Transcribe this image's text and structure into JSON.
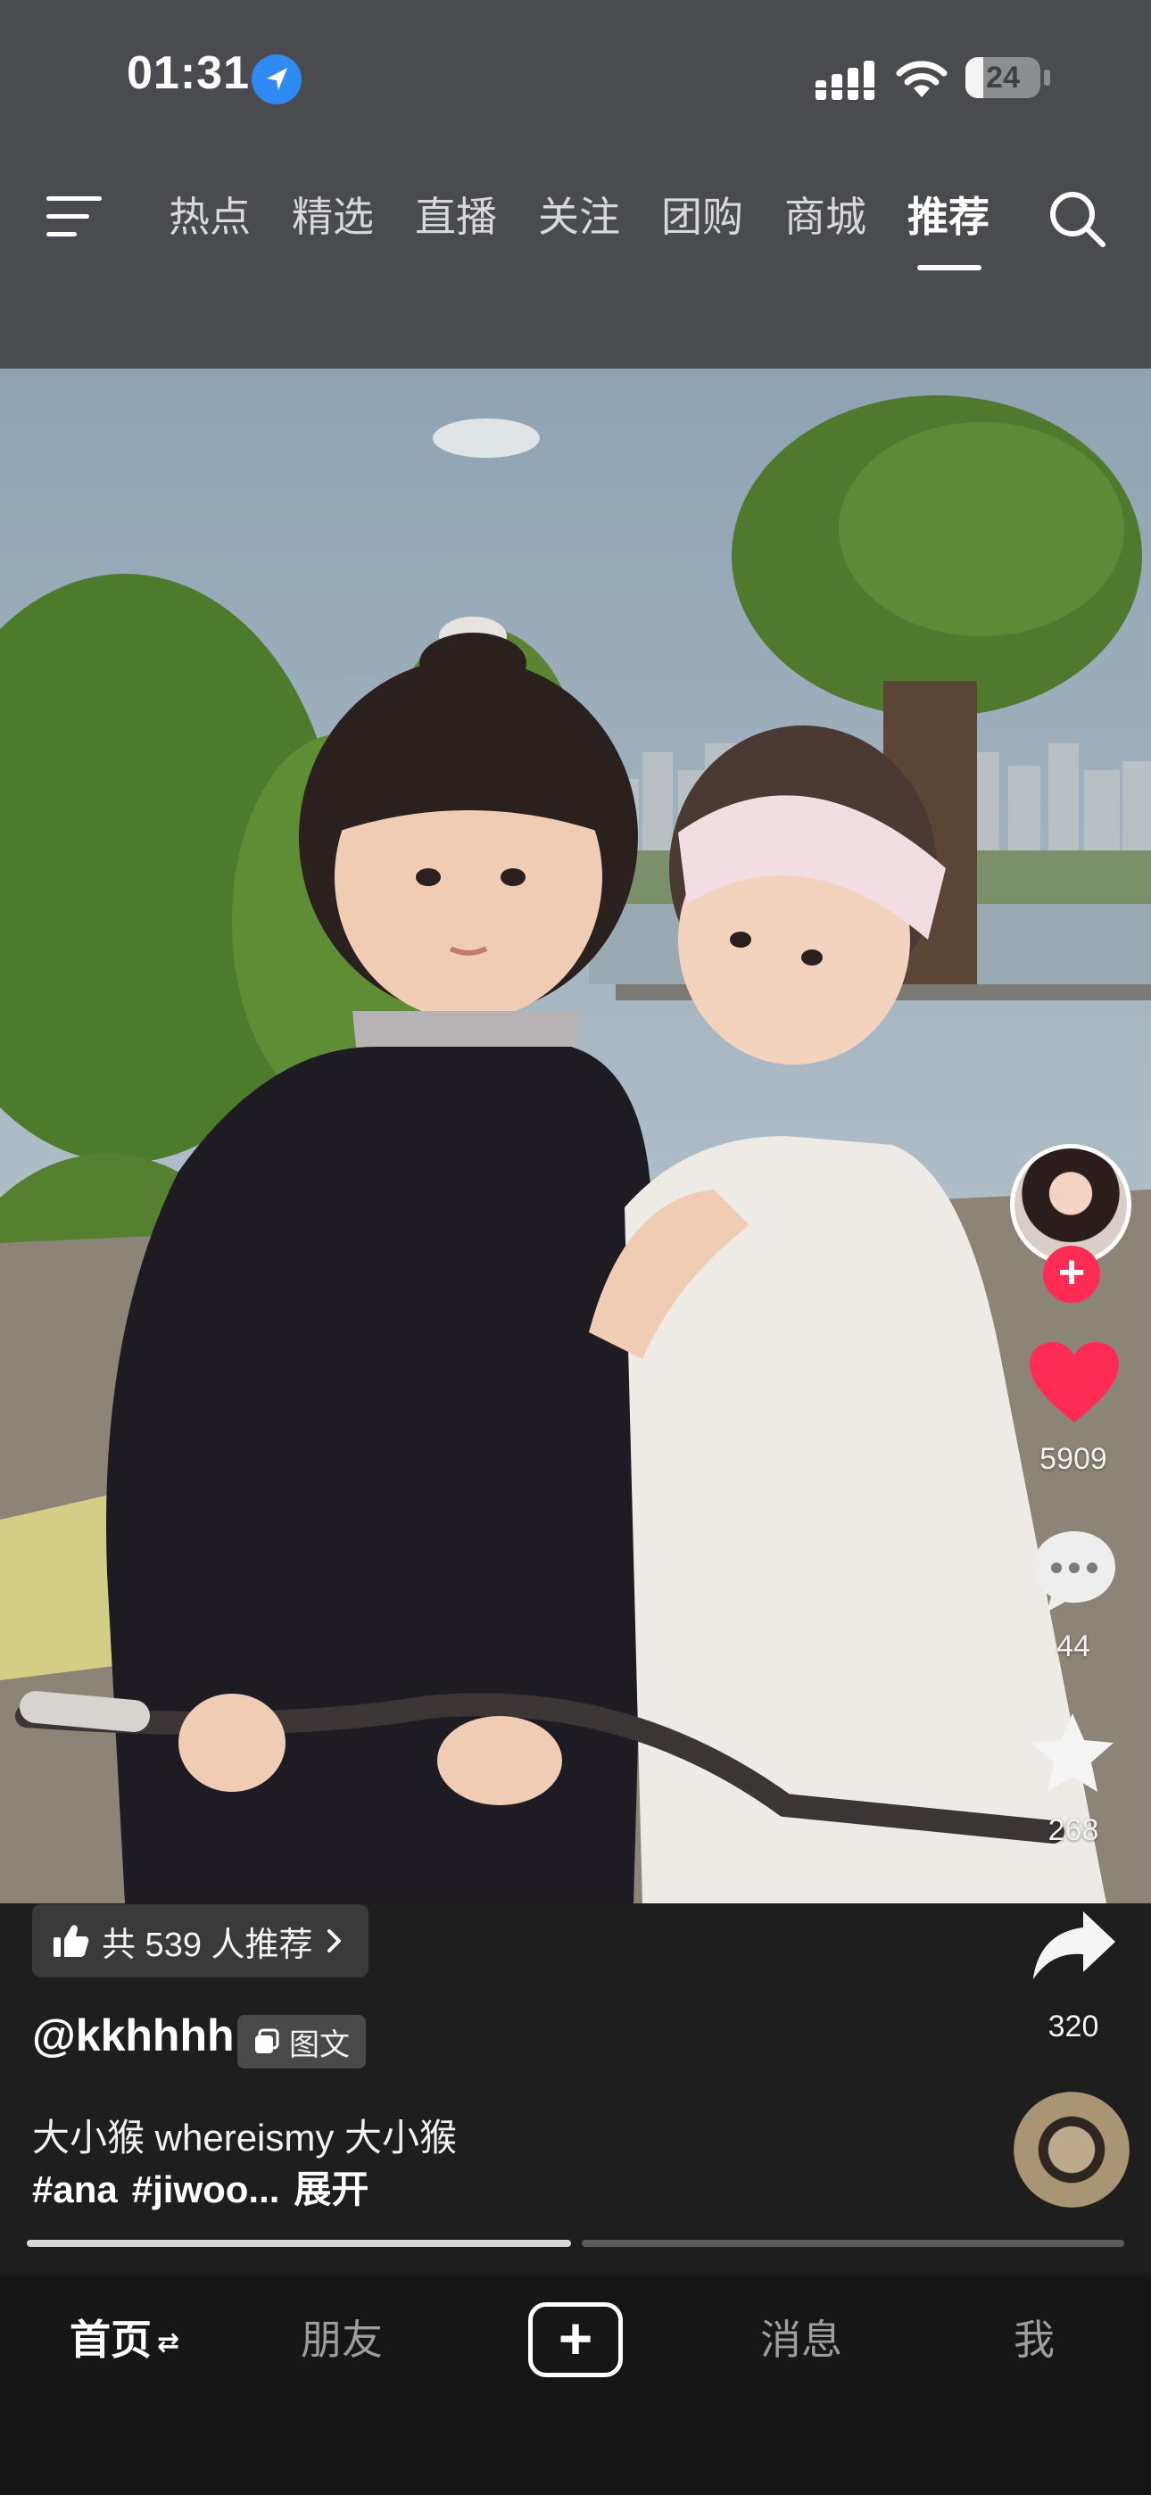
{
  "status_bar": {
    "time": "01:31",
    "battery": "24"
  },
  "nav": {
    "tabs": [
      {
        "label": "热点"
      },
      {
        "label": "精选"
      },
      {
        "label": "直播"
      },
      {
        "label": "关注"
      },
      {
        "label": "团购"
      },
      {
        "label": "商城"
      },
      {
        "label": "推荐",
        "active": true
      }
    ]
  },
  "post": {
    "actions": {
      "likes": "5909",
      "comments": "44",
      "favorites": "268",
      "shares": "320"
    },
    "recommend_text": "共 539 人推荐",
    "author": "@kkhhhh",
    "type_badge": "图文",
    "description": "大小猴 whereismy 大小猴",
    "tags": [
      "#ana",
      "#jiwoo..."
    ],
    "expand_label": "展开",
    "progress": [
      1.0,
      0.0
    ]
  },
  "tabbar": {
    "home": "首页",
    "home_swap": "⇄",
    "friends": "朋友",
    "create": "+",
    "messages": "消息",
    "me": "我"
  },
  "colors": {
    "like": "#fe2c55",
    "follow": "#fe2c55",
    "header_bg": "#4a4b4e",
    "tabbar_bg": "#161616"
  }
}
